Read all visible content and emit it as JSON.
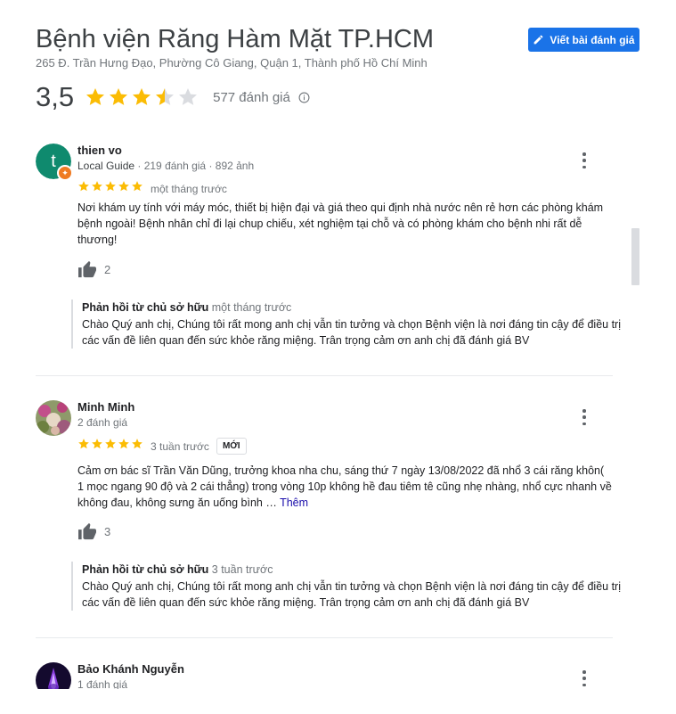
{
  "place": {
    "name": "Bệnh viện Răng Hàm Mặt TP.HCM",
    "address": "265 Đ. Trần Hưng Đạo, Phường Cô Giang, Quận 1, Thành phố Hồ Chí Minh",
    "write_review_label": "Viết bài đánh giá",
    "rating": "3,5",
    "rating_value": 3.5,
    "review_count": "577 đánh giá"
  },
  "colors": {
    "star": "#fbbc04",
    "star_empty": "#dadce0",
    "accent": "#1a73e8"
  },
  "reviews": [
    {
      "avatar_letter": "t",
      "author": "thien vo",
      "meta_prefix": "Local Guide",
      "meta_rest": " · 219 đánh giá · 892 ảnh",
      "stars": 5,
      "time": "một tháng trước",
      "text": "Nơi khám uy tính với máy móc, thiết bị hiện đại và giá theo qui định nhà nước nên rẻ hơn các phòng khám bệnh ngoài! Bệnh nhân chỉ đi lại chup chiếu, xét nghiệm tại chỗ và có phòng khám cho bệnh nhi rất dễ thương!",
      "likes": "2",
      "reply_label": "Phản hồi từ chủ sở hữu",
      "reply_time": "một tháng trước",
      "reply_text": "Chào Quý anh chị, Chúng tôi rất mong anh chị vẫn tin tưởng và chọn Bệnh viện là nơi đáng tin cậy để điều trị các vấn đề liên quan đến sức khỏe răng miệng. Trân trọng cảm ơn anh chị đã đánh giá BV"
    },
    {
      "author": "Minh Minh",
      "meta": "2 đánh giá",
      "stars": 5,
      "time": "3 tuần trước",
      "badge": "MỚI",
      "text": "Cảm ơn bác sĩ Trần Văn Dũng, trưởng khoa nha chu, sáng thứ 7 ngày 13/08/2022 đã nhổ 3 cái răng khôn( 1 mọc ngang 90 độ và 2 cái thẳng) trong vòng 10p không hề đau tiêm tê cũng nhẹ nhàng, nhổ cực nhanh về không đau, không sưng ăn uống bình …",
      "more_label": "Thêm",
      "likes": "3",
      "reply_label": "Phản hồi từ chủ sở hữu",
      "reply_time": "3 tuần trước",
      "reply_text": "Chào Quý anh chị, Chúng tôi rất mong anh chị vẫn tin tưởng và chọn Bệnh viện là nơi đáng tin cậy để điều trị các vấn đề liên quan đến sức khỏe răng miệng. Trân trọng cảm ơn anh chị đã đánh giá BV"
    },
    {
      "author": "Bảo Khánh Nguyễn",
      "meta": "1 đánh giá"
    }
  ]
}
